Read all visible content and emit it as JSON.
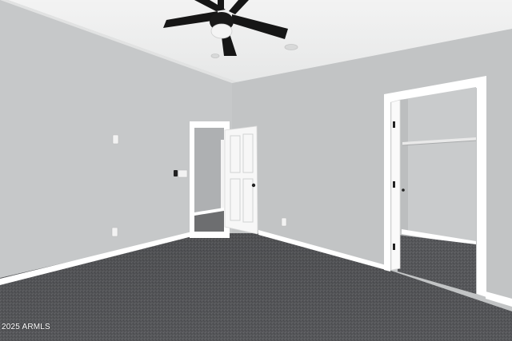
{
  "watermark": {
    "text": "2025 ARMLS"
  },
  "colors": {
    "wall_left": "#c6c8c9",
    "wall_right": "#c2c4c5",
    "ceiling": "#eeefef",
    "carpet": "#56575a",
    "trim": "#ffffff",
    "fan": "#161616"
  },
  "icons": {
    "fan": "ceiling-fan-icon",
    "outlet": "outlet-icon",
    "switch": "light-switch-icon",
    "thermostat": "thermostat-icon"
  }
}
